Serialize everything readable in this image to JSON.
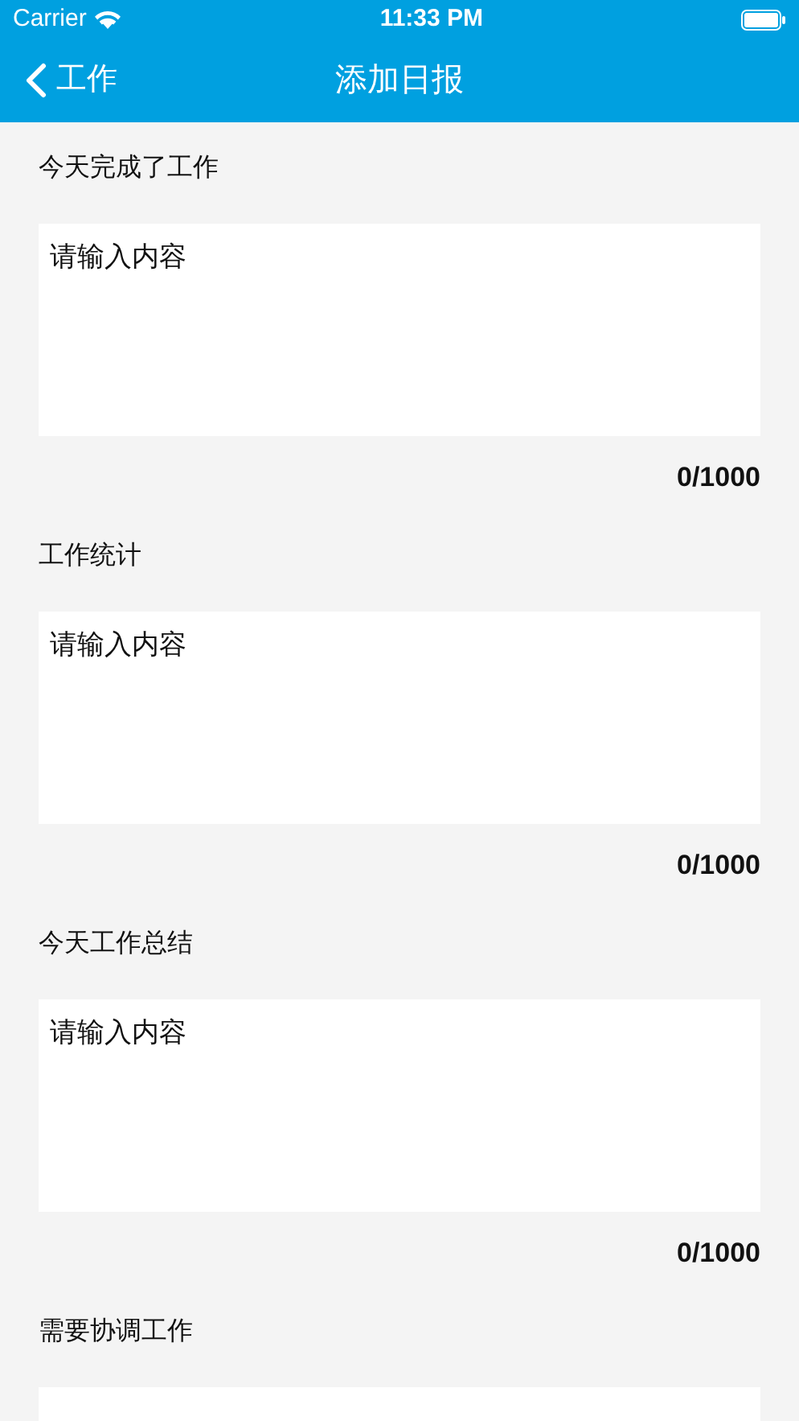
{
  "status_bar": {
    "carrier": "Carrier",
    "time": "11:33 PM"
  },
  "nav_bar": {
    "back_label": "工作",
    "title": "添加日报"
  },
  "sections": [
    {
      "label": "今天完成了工作",
      "placeholder": "请输入内容",
      "counter": "0/1000"
    },
    {
      "label": "工作统计",
      "placeholder": "请输入内容",
      "counter": "0/1000"
    },
    {
      "label": "今天工作总结",
      "placeholder": "请输入内容",
      "counter": "0/1000"
    },
    {
      "label": "需要协调工作"
    }
  ]
}
